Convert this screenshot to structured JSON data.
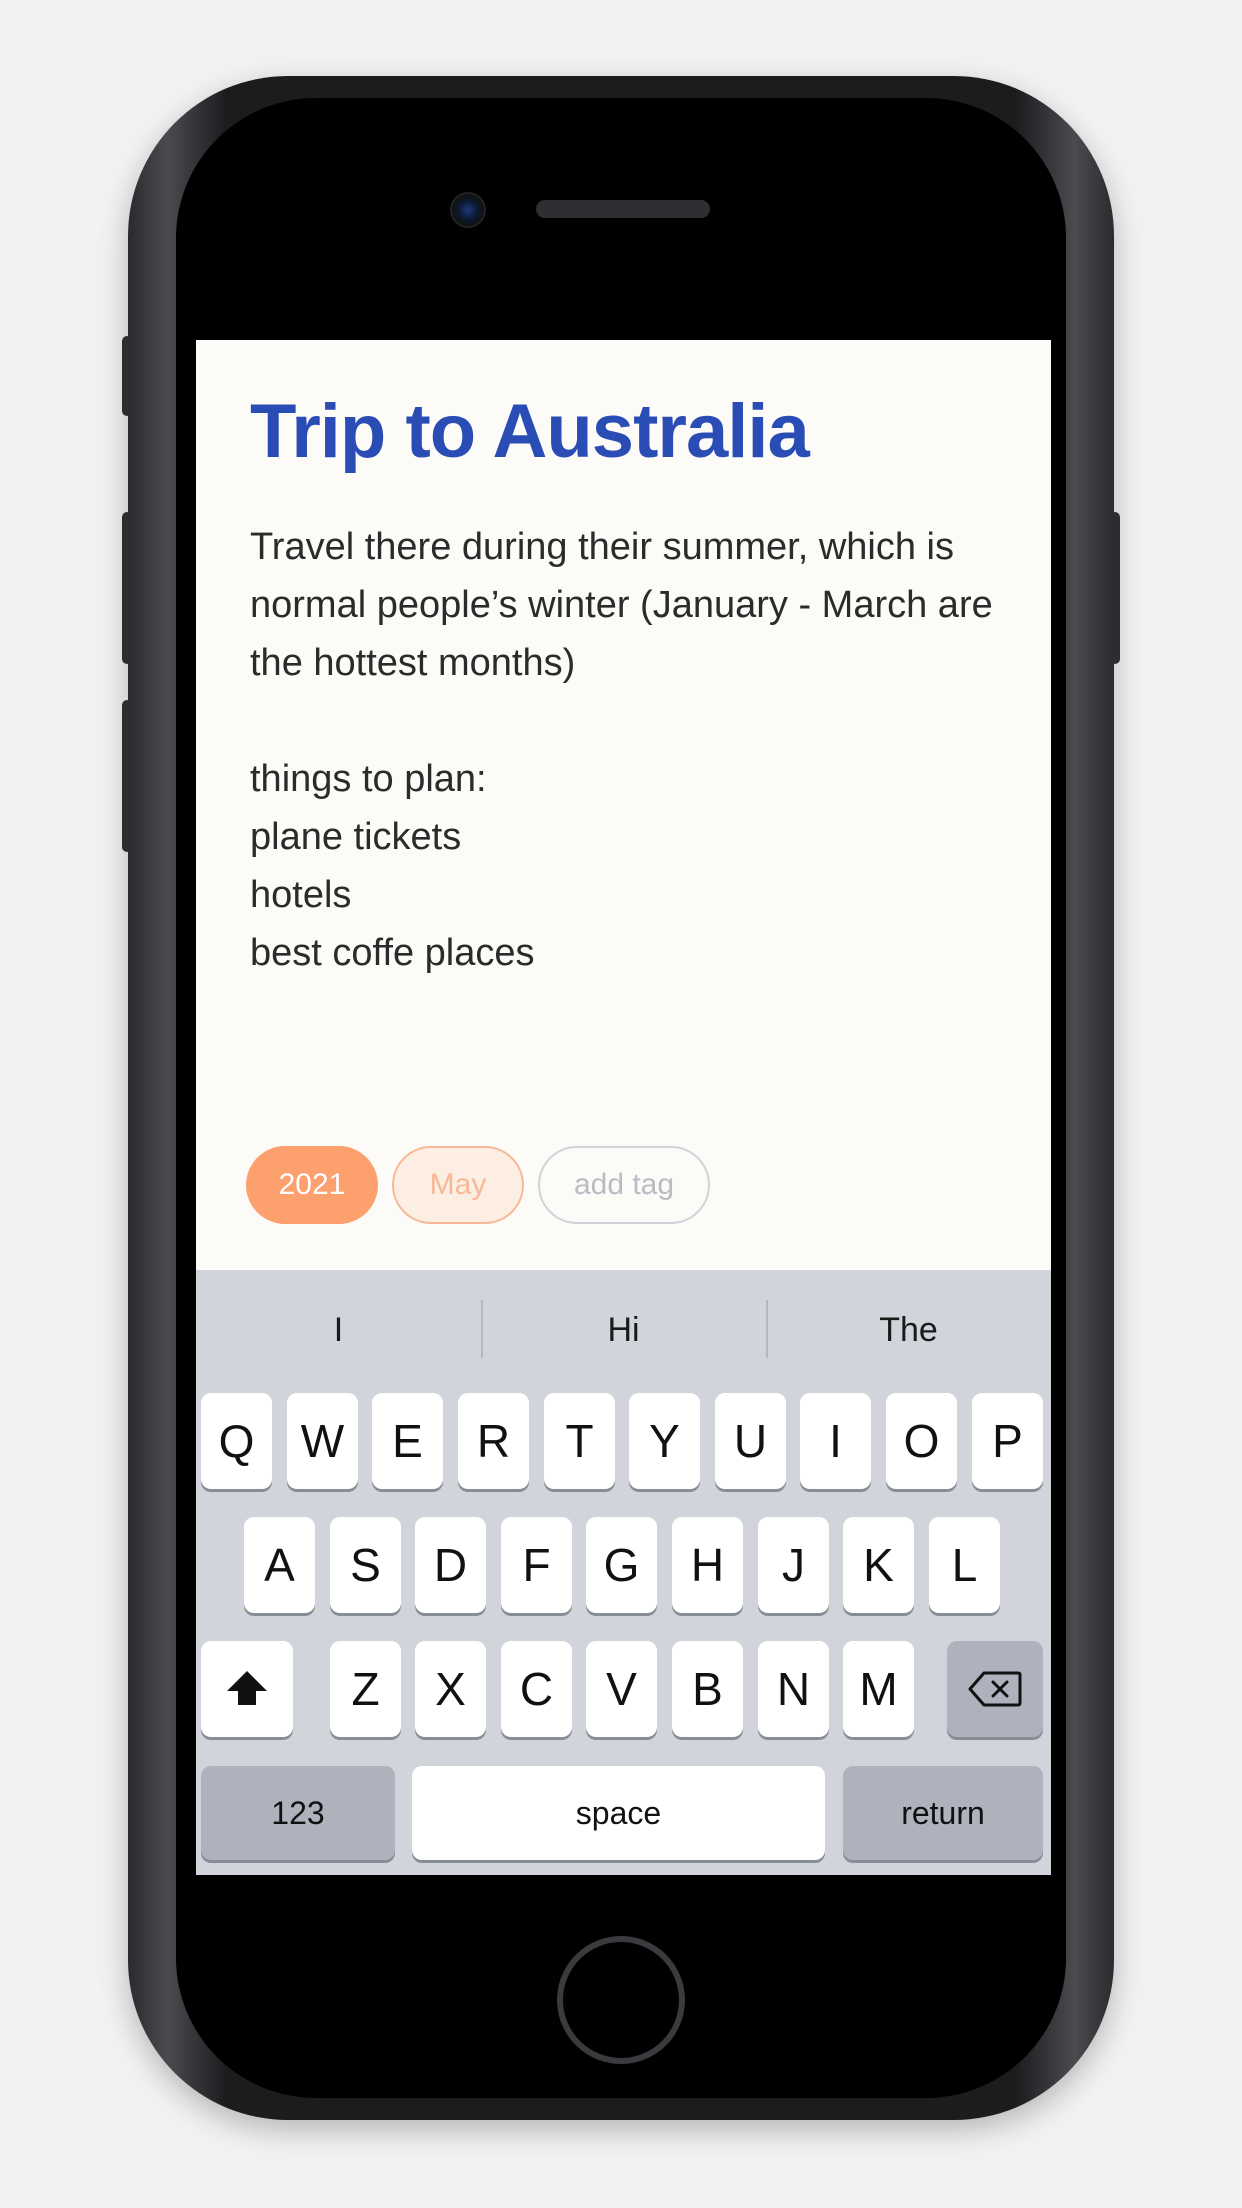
{
  "note": {
    "title": "Trip to Australia",
    "body": "Travel there during their summer, which is normal people’s winter (January - March are the hottest months)\n\nthings to plan:\nplane tickets\nhotels\nbest coffe places"
  },
  "tags": {
    "year": "2021",
    "month": "May",
    "add_label": "add tag"
  },
  "keyboard": {
    "suggestions": [
      "I",
      "Hi",
      "The"
    ],
    "row1": [
      "Q",
      "W",
      "E",
      "R",
      "T",
      "Y",
      "U",
      "I",
      "O",
      "P"
    ],
    "row2": [
      "A",
      "S",
      "D",
      "F",
      "G",
      "H",
      "J",
      "K",
      "L"
    ],
    "row3": [
      "Z",
      "X",
      "C",
      "V",
      "B",
      "N",
      "M"
    ],
    "numbers_label": "123",
    "space_label": "space",
    "return_label": "return",
    "shift_icon": "shift-icon",
    "delete_icon": "backspace-icon"
  },
  "colors": {
    "title": "#2a4db5",
    "tag_year": "#fca06d",
    "tag_month_border": "#f6b896"
  }
}
